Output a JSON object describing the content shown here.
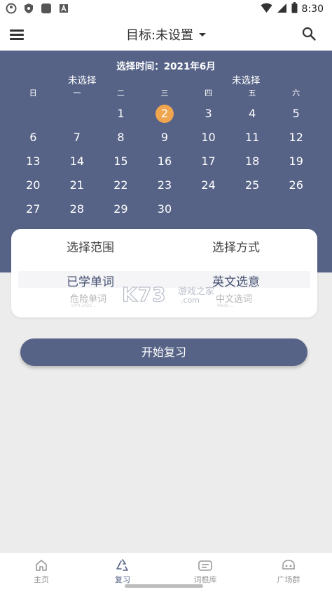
{
  "status_bar": {
    "time": "8:30",
    "left_icons": [
      "app-logo-icon",
      "shield-icon",
      "square-app-icon",
      "font-icon"
    ],
    "right_icons": [
      "wifi-icon",
      "signal-icon",
      "battery-icon"
    ]
  },
  "app_bar": {
    "menu_icon": "menu-icon",
    "title": "目标:未设置",
    "dropdown_icon": "caret-down-icon",
    "search_icon": "search-icon"
  },
  "calendar": {
    "title": "选择时间：2021年6月",
    "left_unselected": "未选择",
    "right_unselected": "未选择",
    "weekdays": [
      "日",
      "一",
      "二",
      "三",
      "四",
      "五",
      "六"
    ],
    "days": [
      "1",
      "2",
      "3",
      "4",
      "5",
      "6",
      "7",
      "8",
      "9",
      "10",
      "11",
      "12",
      "13",
      "14",
      "15",
      "16",
      "17",
      "18",
      "19",
      "20",
      "21",
      "22",
      "23",
      "24",
      "25",
      "26",
      "27",
      "28",
      "29",
      "30"
    ],
    "selected_day": "2",
    "colors": {
      "background": "#566386",
      "selected": "#f0a64f"
    }
  },
  "picker_card": {
    "range_header": "选择范围",
    "mode_header": "选择方式",
    "range_selected": "已学单词",
    "range_next": "危险单词",
    "mode_selected": "英文选意",
    "mode_next": "中文选词",
    "range_tiny": "OPR 2021 ...",
    "mode_tiny": "Mode ..."
  },
  "watermark": {
    "brand": "K73",
    "cn": "游戏之家",
    "domain": ".com"
  },
  "start_button": {
    "label": "开始复习"
  },
  "bottom_nav": {
    "items": [
      {
        "label": "主页",
        "icon": "home-icon",
        "active": false
      },
      {
        "label": "复习",
        "icon": "recycle-icon",
        "active": true
      },
      {
        "label": "词根库",
        "icon": "dictionary-icon",
        "active": false
      },
      {
        "label": "广场群",
        "icon": "community-icon",
        "active": false
      }
    ],
    "colors": {
      "active": "#566386",
      "inactive": "#999999"
    }
  }
}
